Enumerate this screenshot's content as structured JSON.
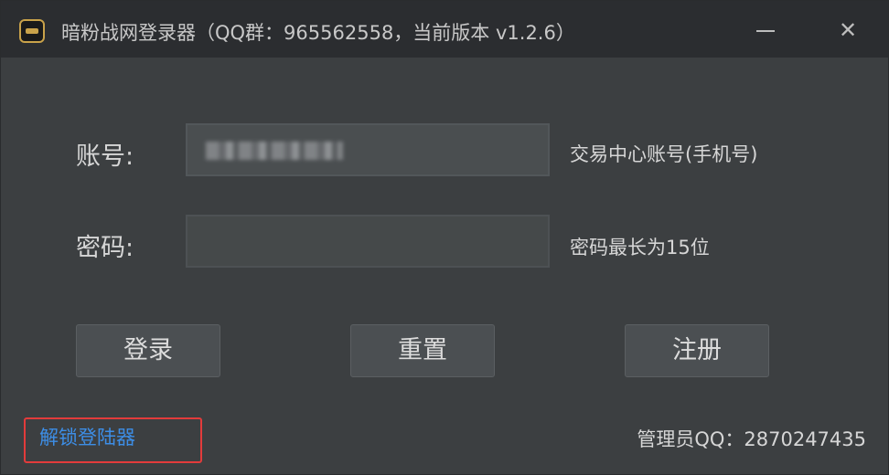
{
  "window": {
    "title": "暗粉战网登录器（QQ群：965562558，当前版本 v1.2.6）",
    "minimize_glyph": "—",
    "close_glyph": "✕",
    "icon": "app-logo-icon"
  },
  "form": {
    "account_label": "账号:",
    "account_value": "",
    "account_hint": "交易中心账号(手机号)",
    "password_label": "密码:",
    "password_value": "",
    "password_hint": "密码最长为15位"
  },
  "buttons": {
    "login": "登录",
    "reset": "重置",
    "register": "注册"
  },
  "footer": {
    "unlock_link": "解锁登陆器",
    "admin_qq": "管理员QQ：2870247435"
  },
  "colors": {
    "link": "#3d8ee6",
    "highlight": "#e23b3b",
    "background": "#3c3f41"
  }
}
